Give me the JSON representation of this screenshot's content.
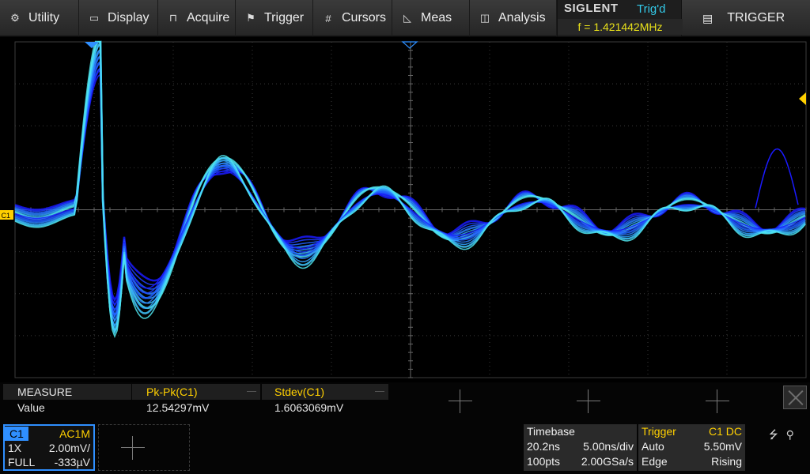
{
  "menu": [
    {
      "label": "Utility",
      "icon": "gear-icon",
      "glyph": "⚙"
    },
    {
      "label": "Display",
      "icon": "monitor-icon",
      "glyph": "▭"
    },
    {
      "label": "Acquire",
      "icon": "acquire-icon",
      "glyph": "⊓"
    },
    {
      "label": "Trigger",
      "icon": "flag-icon",
      "glyph": "⚑"
    },
    {
      "label": "Cursors",
      "icon": "cursors-icon",
      "glyph": "#"
    },
    {
      "label": "Meas",
      "icon": "ruler-icon",
      "glyph": "◺"
    },
    {
      "label": "Analysis",
      "icon": "analysis-icon",
      "glyph": "◫"
    }
  ],
  "brand": "SIGLENT",
  "trigger_status": "Trig'd",
  "frequency": "f = 1.421442MHz",
  "trigger_tab": {
    "label": "TRIGGER",
    "icon": "trigger-menu-icon",
    "glyph": "▤"
  },
  "channel_marker": "C1",
  "measure": {
    "header": "MEASURE",
    "value_label": "Value",
    "items": [
      {
        "name": "Pk-Pk(C1)",
        "value": "12.54297mV"
      },
      {
        "name": "Stdev(C1)",
        "value": "1.6063069mV"
      }
    ]
  },
  "channel1": {
    "name": "C1",
    "coupling": "AC1M",
    "probe": "1X",
    "scale": "2.00mV/",
    "bandwidth": "FULL",
    "offset": "-333µV",
    "color": "#2f8fff"
  },
  "timebase": {
    "title": "Timebase",
    "delay": "20.2ns",
    "scale": "5.00ns/div",
    "points": "100pts",
    "sample_rate": "2.00GSa/s"
  },
  "trigger": {
    "title": "Trigger",
    "source": "C1 DC",
    "mode": "Auto",
    "level": "5.50mV",
    "type": "Edge",
    "slope": "Rising"
  },
  "colors": {
    "accent_yellow": "#ffd000",
    "trace_blue": "#2040ff",
    "trace_cyan": "#40e0ff",
    "panel_gray": "#2a2a2a"
  }
}
